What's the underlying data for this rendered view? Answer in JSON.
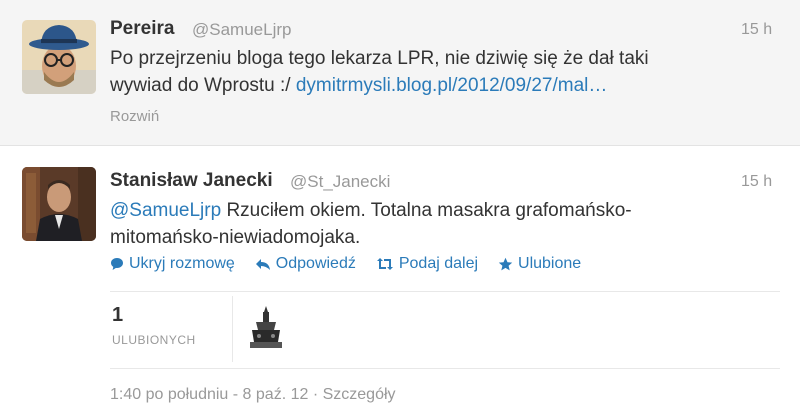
{
  "tweets": [
    {
      "name": "Pereira",
      "handle": "@SamueLjrp",
      "time": "15 h",
      "text_line1": "Po przejrzeniu bloga tego lekarza LPR, nie dziwię się że dał taki",
      "text_line2_prefix": "wywiad do Wprostu :/ ",
      "link": "dymitrmysli.blog.pl/2012/09/27/mal…",
      "expand": "Rozwiń"
    },
    {
      "name": "Stanisław Janecki",
      "handle": "@St_Janecki",
      "time": "15 h",
      "mention": "@SamueLjrp",
      "text_line1_rest": " Rzuciłem okiem. Totalna masakra grafomańsko-",
      "text_line2": "mitomańsko-niewiadomojaka."
    }
  ],
  "actions": {
    "hide": "Ukryj rozmowę",
    "reply": "Odpowiedź",
    "retweet": "Podaj dalej",
    "favorite": "Ulubione"
  },
  "stats": {
    "favorites_count": "1",
    "favorites_label": "ULUBIONYCH"
  },
  "meta": "1:40 po południu - 8 paź. 12 · Szczegóły",
  "icons": {
    "hide": "speech-bubble-icon",
    "reply": "reply-arrow-icon",
    "retweet": "retweet-icon",
    "favorite": "star-icon"
  },
  "colors": {
    "link": "#2b7bb9",
    "muted": "#999999",
    "text": "#333333"
  }
}
